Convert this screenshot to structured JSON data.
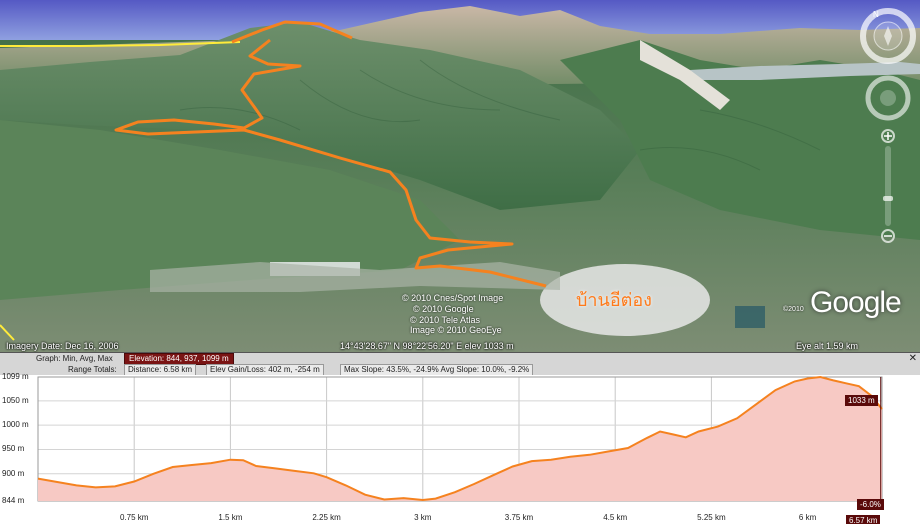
{
  "map": {
    "imagery_date": "Imagery Date: Dec 16, 2006",
    "coordinates": "14°43'28.67\" N    98°22'56.20\" E   elev  1033 m",
    "eye_alt": "Eye alt    1.59 km",
    "credits": [
      "© 2010 Cnes/Spot Image",
      "© 2010 Google",
      "© 2010 Tele Atlas",
      "Image © 2010 GeoEye"
    ],
    "place_label": "บ้านอีต่อง",
    "logo_text": "Google",
    "logo_year": "©2010",
    "route_color": "#f5821f",
    "road_color": "#ffeb3b"
  },
  "nav": {
    "look_icon": "compass-look-icon",
    "move_icon": "move-joystick-icon",
    "zoom_in_icon": "zoom-in-icon",
    "zoom_out_icon": "zoom-out-icon",
    "north_label": "N"
  },
  "profile": {
    "graph_label": "Graph: Min, Avg, Max",
    "elevation_summary": "Elevation: 844, 937, 1099 m",
    "range_totals_label": "Range Totals:",
    "distance": "Distance: 6.58 km",
    "elev_gain_loss": "Elev Gain/Loss: 402 m, -254 m",
    "slopes": "Max Slope: 43.5%, -24.9% Avg Slope: 10.0%, -9.2%",
    "close_label": "✕",
    "cursor_elevation": "1033 m",
    "cursor_slope": "-6.0%",
    "cursor_distance": "6.57 km",
    "fill_color": "#f7c9c4",
    "line_color": "#f5821f",
    "y_tick_labels": [
      "1099 m",
      "1050 m",
      "1000 m",
      "950 m",
      "900 m",
      "844 m"
    ],
    "x_tick_labels": [
      "0.75 km",
      "1.5 km",
      "2.25 km",
      "3 km",
      "3.75 km",
      "4.5 km",
      "5.25 km",
      "6 km"
    ]
  },
  "chart_data": {
    "type": "area",
    "xlabel": "",
    "ylabel": "",
    "xlim": [
      0,
      6.58
    ],
    "ylim": [
      844,
      1099
    ],
    "y_ticks": [
      1099,
      1050,
      1000,
      950,
      900,
      844
    ],
    "x_ticks": [
      0.75,
      1.5,
      2.25,
      3,
      3.75,
      4.5,
      5.25,
      6
    ],
    "series": [
      {
        "values": [
          [
            0,
            890
          ],
          [
            0.15,
            883
          ],
          [
            0.3,
            876
          ],
          [
            0.45,
            872
          ],
          [
            0.6,
            874
          ],
          [
            0.75,
            884
          ],
          [
            0.9,
            900
          ],
          [
            1.05,
            914
          ],
          [
            1.2,
            918
          ],
          [
            1.35,
            922
          ],
          [
            1.5,
            929
          ],
          [
            1.6,
            928
          ],
          [
            1.7,
            916
          ],
          [
            1.85,
            911
          ],
          [
            2.0,
            906
          ],
          [
            2.15,
            901
          ],
          [
            2.25,
            893
          ],
          [
            2.4,
            876
          ],
          [
            2.55,
            857
          ],
          [
            2.7,
            847
          ],
          [
            2.85,
            850
          ],
          [
            3.0,
            846
          ],
          [
            3.1,
            849
          ],
          [
            3.25,
            862
          ],
          [
            3.4,
            879
          ],
          [
            3.55,
            897
          ],
          [
            3.7,
            915
          ],
          [
            3.85,
            926
          ],
          [
            4.0,
            929
          ],
          [
            4.15,
            935
          ],
          [
            4.3,
            939
          ],
          [
            4.45,
            946
          ],
          [
            4.6,
            953
          ],
          [
            4.75,
            974
          ],
          [
            4.85,
            987
          ],
          [
            4.95,
            981
          ],
          [
            5.05,
            975
          ],
          [
            5.15,
            987
          ],
          [
            5.3,
            997
          ],
          [
            5.45,
            1014
          ],
          [
            5.6,
            1043
          ],
          [
            5.75,
            1072
          ],
          [
            5.9,
            1090
          ],
          [
            6.0,
            1096
          ],
          [
            6.1,
            1099
          ],
          [
            6.2,
            1092
          ],
          [
            6.3,
            1086
          ],
          [
            6.4,
            1080
          ],
          [
            6.5,
            1060
          ],
          [
            6.58,
            1033
          ]
        ]
      }
    ]
  }
}
